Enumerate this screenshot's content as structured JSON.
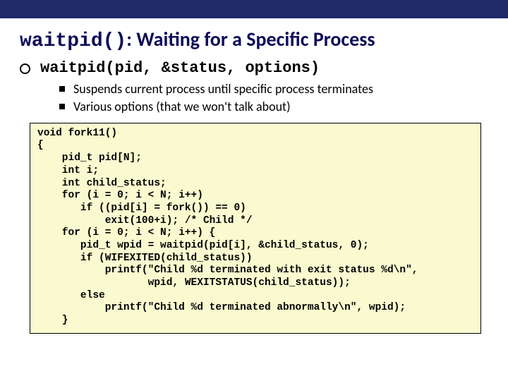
{
  "title": {
    "mono": "waitpid()",
    "rest": ": Waiting for a Specific Process"
  },
  "signature": "waitpid(pid, &status, options)",
  "bullets": [
    "Suspends current process until specific process terminates",
    "Various options (that we won't talk about)"
  ],
  "code": "void fork11()\n{\n    pid_t pid[N];\n    int i;\n    int child_status;\n    for (i = 0; i < N; i++)\n       if ((pid[i] = fork()) == 0)\n           exit(100+i); /* Child */\n    for (i = 0; i < N; i++) {\n       pid_t wpid = waitpid(pid[i], &child_status, 0);\n       if (WIFEXITED(child_status))\n           printf(\"Child %d terminated with exit status %d\\n\",\n                  wpid, WEXITSTATUS(child_status));\n       else\n           printf(\"Child %d terminated abnormally\\n\", wpid);\n    }"
}
